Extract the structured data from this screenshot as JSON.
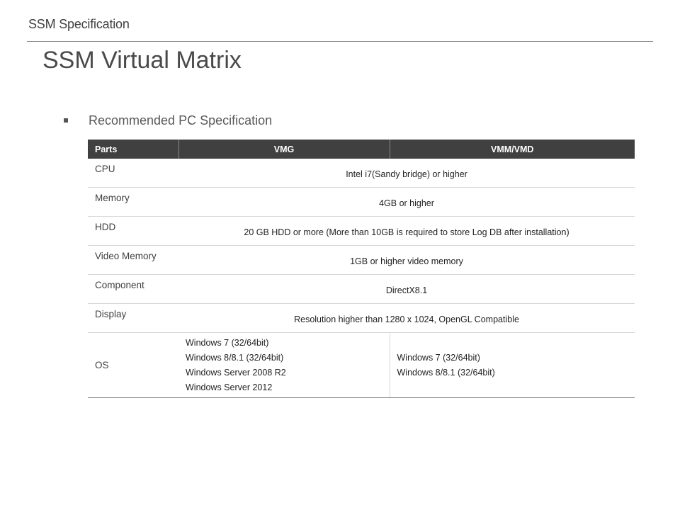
{
  "header": {
    "label": "SSM Specification"
  },
  "title": "SSM Virtual Matrix",
  "section": {
    "title": "Recommended  PC Specification"
  },
  "table": {
    "headers": [
      "Parts",
      "VMG",
      "VMM/VMD"
    ],
    "rows": [
      {
        "part": "CPU",
        "value": "Intel i7(Sandy bridge) or higher"
      },
      {
        "part": "Memory",
        "value": "4GB or higher"
      },
      {
        "part": "HDD",
        "value": "20 GB HDD or more (More than 10GB is required to store Log DB after installation)"
      },
      {
        "part": "Video Memory",
        "value": "1GB or higher video memory"
      },
      {
        "part": "Component",
        "value": "DirectX8.1"
      },
      {
        "part": "Display",
        "value": "Resolution higher than 1280  x 1024,  OpenGL Compatible"
      }
    ],
    "os": {
      "part": "OS",
      "vmg": [
        "Windows 7 (32/64bit)",
        "Windows 8/8.1 (32/64bit)",
        "Windows Server 2008 R2",
        "Windows Server 2012"
      ],
      "vmm": [
        "Windows 7 (32/64bit)",
        "Windows 8/8.1 (32/64bit)"
      ]
    }
  }
}
